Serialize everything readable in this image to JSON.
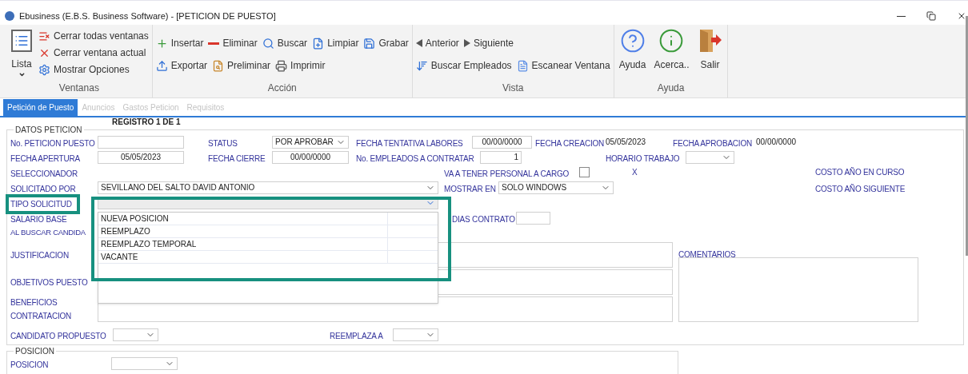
{
  "window": {
    "title": "Ebusiness (E.B.S. Business Software) - [PETICION DE PUESTO]"
  },
  "ribbon": {
    "groups": [
      {
        "label": "Ventanas",
        "large": [
          {
            "label": "Lista",
            "menu": true
          }
        ],
        "lines": [
          {
            "buttons": [
              {
                "label": "Cerrar todas ventanas"
              }
            ]
          },
          {
            "buttons": [
              {
                "label": "Cerrar ventana actual"
              }
            ]
          },
          {
            "buttons": [
              {
                "label": "Mostrar Opciones"
              }
            ]
          }
        ]
      },
      {
        "label": "Acción",
        "lines": [
          {
            "buttons": [
              {
                "label": "Insertar"
              },
              {
                "label": "Eliminar"
              },
              {
                "label": "Buscar"
              },
              {
                "label": "Limpiar"
              },
              {
                "label": "Grabar"
              }
            ]
          },
          {
            "buttons": [
              {
                "label": "Exportar"
              },
              {
                "label": "Preliminar"
              },
              {
                "label": "Imprimir"
              }
            ]
          }
        ]
      },
      {
        "label": "Vista",
        "lines": [
          {
            "buttons": [
              {
                "label": "Anterior"
              },
              {
                "label": "Siguiente"
              }
            ]
          },
          {
            "buttons": [
              {
                "label": "Buscar Empleados"
              },
              {
                "label": "Escanear Ventana"
              }
            ]
          }
        ]
      },
      {
        "label": "Ayuda",
        "large": [
          {
            "label": "Ayuda",
            "menu": false
          },
          {
            "label": "Acerca..",
            "menu": false
          },
          {
            "label": "Salir",
            "menu": false
          }
        ]
      }
    ]
  },
  "tabs": [
    {
      "label": "Petición de Puesto",
      "selected": true
    },
    {
      "label": "Anuncios",
      "selected": false
    },
    {
      "label": "Gastos Peticion",
      "selected": false
    },
    {
      "label": "Requisitos",
      "selected": false
    }
  ],
  "form": {
    "record": "REGISTRO 1 DE 1",
    "section": "DATOS PETICION",
    "no_peticion_puesto": {
      "label": "No. PETICION PUESTO"
    },
    "status": {
      "label": "STATUS",
      "value": "POR APROBAR"
    },
    "fecha_tentativa_labores": {
      "label": "FECHA TENTATIVA LABORES",
      "value": "00/00/0000"
    },
    "fecha_creacion": {
      "label": "FECHA CREACION",
      "value": "05/05/2023"
    },
    "fecha_aprobacion": {
      "label": "FECHA APROBACION",
      "value": "00/00/0000"
    },
    "fecha_apertura": {
      "label": "FECHA APERTURA",
      "value": "05/05/2023"
    },
    "fecha_cierre": {
      "label": "FECHA CIERRE",
      "value": "00/00/0000"
    },
    "no_empleados": {
      "label": "No. EMPLEADOS A CONTRATAR",
      "value": "1"
    },
    "horario_trabajo": {
      "label": "HORARIO TRABAJO"
    },
    "seleccionador": {
      "label": "SELECCIONADOR"
    },
    "personal_a_cargo": {
      "label": "VA A TENER PERSONAL A CARGO",
      "checked": false
    },
    "mark": "X",
    "costo_ano_en_curso": {
      "label": "COSTO AÑO EN CURSO"
    },
    "solicitado_por": {
      "label": "SOLICITADO POR",
      "value": "SEVILLANO DEL SALTO DAVID ANTONIO"
    },
    "mostrar_en": {
      "label": "MOSTRAR EN",
      "value": "SOLO WINDOWS"
    },
    "costo_ano_siguiente": {
      "label": "COSTO AÑO SIGUIENTE"
    },
    "tipo_solicitud": {
      "label": "TIPO SOLICITUD",
      "expanded": true,
      "options": [
        {
          "label": "NUEVA POSICION",
          "selected": false
        },
        {
          "label": "REEMPLAZO",
          "selected": false
        },
        {
          "label": "REEMPLAZO TEMPORAL",
          "selected": false
        },
        {
          "label": "VACANTE",
          "selected": false
        }
      ]
    },
    "salario_base": {
      "label": "SALARIO BASE"
    },
    "dias_contrato": {
      "label": "DIAS CONTRATO"
    },
    "al_buscar": {
      "label": "AL BUSCAR CANDIDA"
    },
    "justificacion": {
      "label": "JUSTIFICACION"
    },
    "objetivos_puesto": {
      "label": "OBJETIVOS PUESTO"
    },
    "beneficios_contratacion": {
      "label": "BENEFICIOS CONTRATACION"
    },
    "comentarios": {
      "label": "COMENTARIOS"
    },
    "candidato_propuesto": {
      "label": "CANDIDATO PROPUESTO"
    },
    "reemplaza_a": {
      "label": "REEMPLAZA A"
    }
  },
  "posicion": {
    "section": "POSICION",
    "posicion": {
      "label": "POSICION"
    }
  }
}
